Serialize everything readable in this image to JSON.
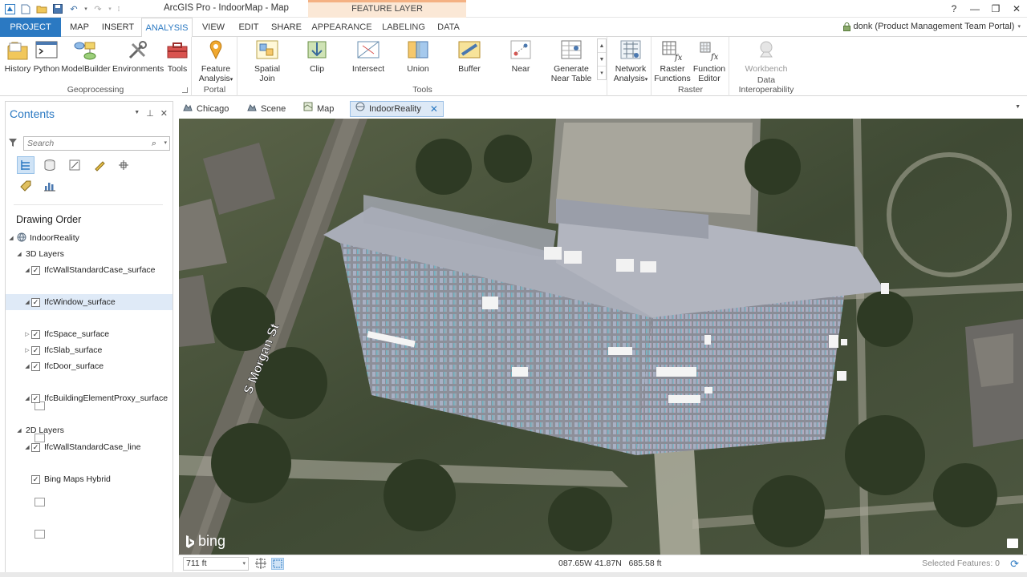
{
  "window": {
    "title": "ArcGIS Pro - IndoorMap - Map",
    "context_tab_group": "FEATURE LAYER",
    "user": "donk (Product Management Team Portal)"
  },
  "ribbon_tabs": [
    "PROJECT",
    "MAP",
    "INSERT",
    "ANALYSIS",
    "VIEW",
    "EDIT",
    "SHARE",
    "APPEARANCE",
    "LABELING",
    "DATA"
  ],
  "active_tab": "ANALYSIS",
  "ribbon": {
    "geoprocessing": {
      "label": "Geoprocessing",
      "buttons": [
        "History",
        "Python",
        "ModelBuilder",
        "Environments",
        "Tools"
      ]
    },
    "portal": {
      "label": "Portal",
      "feature_analysis": [
        "Feature",
        "Analysis"
      ]
    },
    "tools": {
      "label": "Tools",
      "buttons": [
        [
          "Spatial",
          "Join"
        ],
        [
          "Clip",
          ""
        ],
        [
          "Intersect",
          ""
        ],
        [
          "Union",
          ""
        ],
        [
          "Buffer",
          ""
        ],
        [
          "Near",
          ""
        ],
        [
          "Generate",
          "Near Table"
        ]
      ]
    },
    "network": {
      "line1": "Network",
      "line2": "Analysis"
    },
    "raster": {
      "label": "Raster",
      "raster_functions": [
        "Raster",
        "Functions"
      ],
      "function_editor": [
        "Function",
        "Editor"
      ]
    },
    "interop": {
      "label": "Data Interoperability",
      "workbench": "Workbench"
    }
  },
  "contents": {
    "title": "Contents",
    "search_placeholder": "Search",
    "drawing_order_label": "Drawing Order",
    "map_name": "IndoorReality",
    "group_3d": "3D Layers",
    "group_2d": "2D Layers",
    "layers_3d": [
      "IfcWallStandardCase_surface",
      "IfcWindow_surface",
      "IfcSpace_surface",
      "IfcSlab_surface",
      "IfcDoor_surface",
      "IfcBuildingElementProxy_surface"
    ],
    "layers_2d": [
      "IfcWallStandardCase_line",
      "Bing Maps Hybrid"
    ],
    "selected_layer": "IfcWindow_surface"
  },
  "view_tabs": [
    {
      "label": "Chicago",
      "icon": "scene-icon"
    },
    {
      "label": "Scene",
      "icon": "scene-icon"
    },
    {
      "label": "Map",
      "icon": "map-icon"
    },
    {
      "label": "IndoorReality",
      "icon": "globe-icon"
    }
  ],
  "active_view": "IndoorReality",
  "map": {
    "street_label": "S Morgan St",
    "attribution": "bing"
  },
  "status": {
    "scale": "711 ft",
    "coordinates": "087.65W 41.87N   685.58 ft",
    "selected_features": "Selected Features: 0"
  },
  "colors": {
    "accent": "#2b79c2",
    "context_tab": "#f4b183"
  }
}
